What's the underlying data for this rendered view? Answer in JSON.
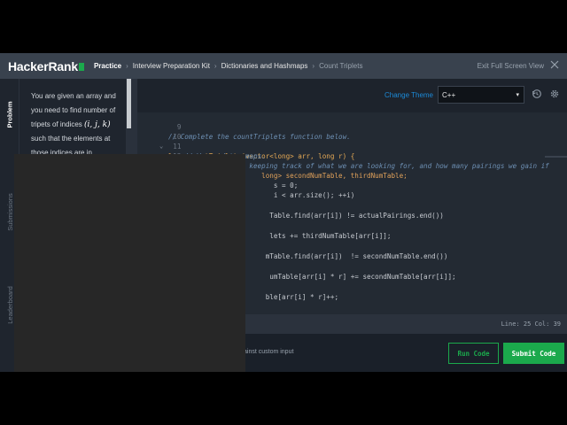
{
  "header": {
    "logo": "HackerRank",
    "breadcrumbs": [
      "Practice",
      "Interview Preparation Kit",
      "Dictionaries and Hashmaps",
      "Count Triplets"
    ],
    "exit_label": "Exit Full Screen View"
  },
  "tabs": [
    "Problem",
    "Submissions",
    "Leaderboard"
  ],
  "problem": {
    "text_before": "You are given an array and you need to find number of tripets of indices",
    "indices": "(i, j, k)",
    "text_after": "such that the elements at those indices are in"
  },
  "editor": {
    "change_theme": "Change Theme",
    "language": "C++",
    "code_lines": [
      {
        "num": "9",
        "text": "// Complete the countTriplets function below."
      },
      {
        "num": "10",
        "text": "long countTriplets(vector<long> arr, long r) {"
      },
      {
        "num": "11",
        "text": "    // We need two maps."
      },
      {
        "num": "12",
        "text": "    // First map is keeping track of what we are looking for, and how many pairings we gain if"
      },
      {
        "num": "",
        "text": "                       long> secondNumTable, thirdNumTable;"
      },
      {
        "num": "",
        "text": "                          s = 0;"
      },
      {
        "num": "",
        "text": "                          i < arr.size(); ++i)"
      },
      {
        "num": "",
        "text": "                         Table.find(arr[i]) != actualPairings.end())"
      },
      {
        "num": "",
        "text": "                         lets += thirdNumTable[arr[i]];"
      },
      {
        "num": "",
        "text": "                        mTable.find(arr[i])  != secondNumTable.end())"
      },
      {
        "num": "",
        "text": "                         umTable[arr[i] * r] += secondNumTable[arr[i]];"
      },
      {
        "num": "",
        "text": "                        ble[arr[i] * r]++;"
      }
    ],
    "status": "Line: 25 Col: 39",
    "custom_input_label": "ainst custom input",
    "run_label": "Run Code",
    "submit_label": "Submit Code"
  }
}
